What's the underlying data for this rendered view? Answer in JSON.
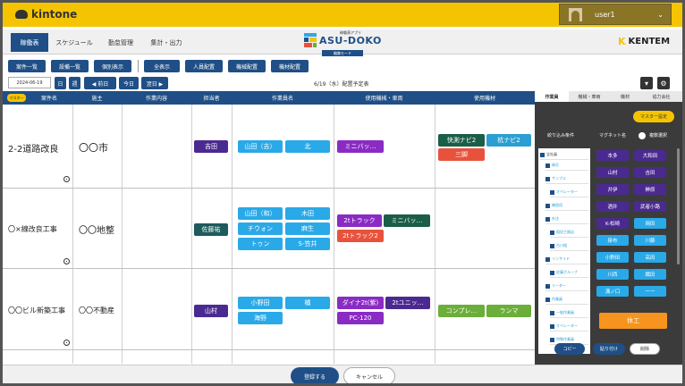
{
  "app": {
    "logo_text": "kintone"
  },
  "user": {
    "name": "user1"
  },
  "nav": {
    "tabs": [
      "稼働表",
      "スケジュール",
      "勤怠管理",
      "集計・出力"
    ],
    "brand": {
      "sub": "稼働表アプリ",
      "name": "ASU-DOKO",
      "mode": "編集モード"
    },
    "company": "KENTEM"
  },
  "toolbar": {
    "left_buttons": [
      "案件一覧",
      "設備一覧",
      "個別表示"
    ],
    "right_buttons": [
      "全表示",
      "人員配置",
      "機械配置",
      "機材配置"
    ]
  },
  "datebar": {
    "date": "2024-06-19",
    "day_label": "日",
    "week_label": "週",
    "prev_label": "◀ 前日",
    "today_label": "今日",
    "next_label": "翌日 ▶",
    "title": "6/19（水）配置予定表"
  },
  "grid": {
    "master_tag": "マスター",
    "headers": [
      "案件名",
      "施主",
      "作業内容",
      "担当者",
      "作業員名",
      "使用機械・車両",
      "使用機材"
    ],
    "rows": [
      {
        "case": "2-2道路改良",
        "owner": "〇〇市",
        "manager": "吉田",
        "workers": [
          "山田（吉）",
          "北"
        ],
        "machines": [
          "ミニバッ…"
        ],
        "equipment": [
          "快測ナビ2",
          "杭ナビ2",
          "三脚"
        ]
      },
      {
        "case": "〇×線改良工事",
        "owner": "〇〇地整",
        "manager": "佐藤祐",
        "workers": [
          "山田（和）",
          "木田",
          "チウォン",
          "麻生",
          "トゥン",
          "S-笠井"
        ],
        "machines": [
          "2tトラック",
          "ミニバッ…",
          "2tトラック2"
        ],
        "equipment": []
      },
      {
        "case": "〇〇ビル新築工事",
        "owner": "〇〇不動産",
        "manager": "山村",
        "workers": [
          "小野田",
          "橘",
          "海野"
        ],
        "machines": [
          "ダイナ2t(紫)",
          "2tユニッ…",
          "PC-120"
        ],
        "equipment": [
          "コンプレ…",
          "ランマ"
        ]
      }
    ]
  },
  "sidebar": {
    "tabs": [
      "作業員",
      "機械・車両",
      "機材",
      "協力会社"
    ],
    "master_button": "マスター設定",
    "filter_label": "絞り込み条件",
    "magnet_label": "マグネット名",
    "multi_label": "複数選択",
    "filters": [
      "全社員",
      "棒芯",
      "サンプル",
      "オペレーター",
      "練習用",
      "外注",
      "稲垣工務店",
      "古川組",
      "インサイド",
      "佐藤グループ",
      "リーダー",
      "作業員",
      "一般作業員",
      "オペレーター",
      "特殊作業員"
    ],
    "magnets": [
      "本多",
      "大和田",
      "山村",
      "吉田",
      "井伊",
      "榊原",
      "酒井",
      "武者小路",
      "K-松崎",
      "岡田",
      "掛布",
      "川藤",
      "小野田",
      "高田",
      "川西",
      "織田",
      "溝ノ口",
      "ーー"
    ],
    "leave_button": "休工",
    "copy_button": "コピー",
    "paste_button": "貼り付け",
    "delete_button": "削除"
  },
  "footer": {
    "register_button": "登録する",
    "cancel_button": "キャンセル"
  },
  "colors": {
    "brand_yellow": "#f5c400",
    "navy": "#1f4f86",
    "accent_orange": "#f7941d"
  }
}
